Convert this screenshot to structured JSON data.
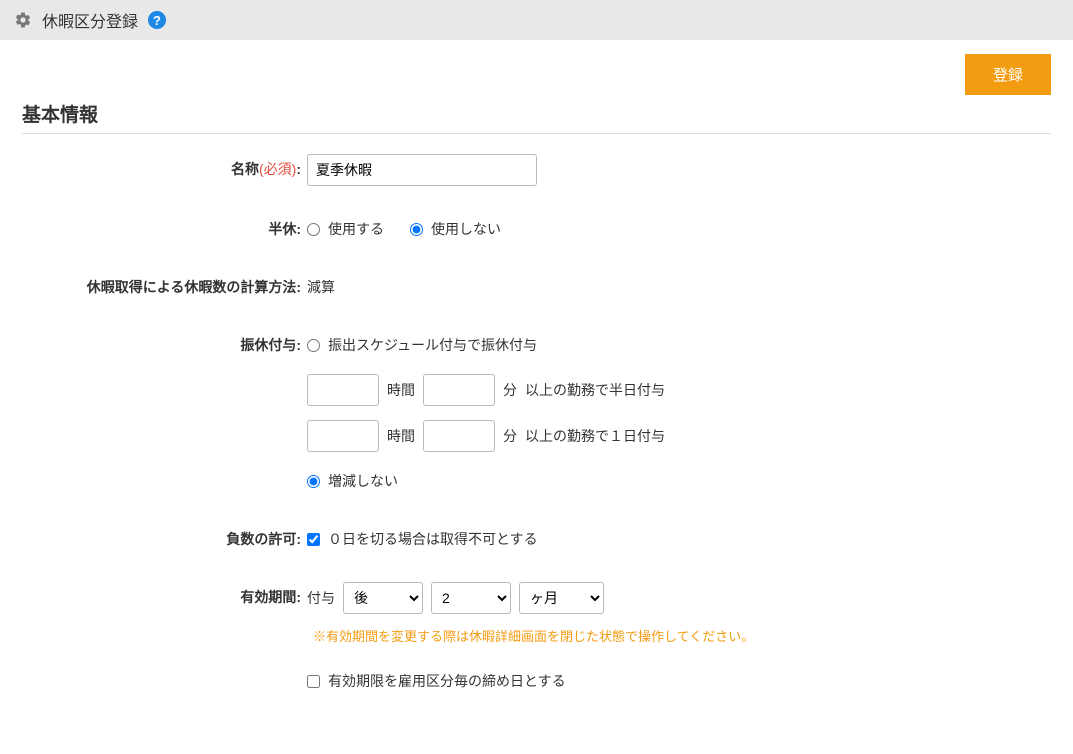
{
  "header": {
    "title": "休暇区分登録",
    "help_label": "?"
  },
  "actions": {
    "register": "登録"
  },
  "section": {
    "title": "基本情報"
  },
  "fields": {
    "name": {
      "label": "名称",
      "required": "(必須)",
      "value": "夏季休暇"
    },
    "halfday": {
      "label": "半休",
      "opt_use": "使用する",
      "opt_not_use": "使用しない"
    },
    "calc_method": {
      "label": "休暇取得による休暇数の計算方法",
      "value": "減算"
    },
    "substitute": {
      "label": "振休付与",
      "opt_schedule": "振出スケジュール付与で振休付与",
      "unit_hours": "時間",
      "unit_minutes": "分",
      "half_day_text": "以上の勤務で半日付与",
      "full_day_text": "以上の勤務で１日付与",
      "opt_none": "増減しない"
    },
    "negative": {
      "label": "負数の許可",
      "check_label": "０日を切る場合は取得不可とする"
    },
    "validity": {
      "label": "有効期間",
      "prefix": "付与",
      "timing_value": "後",
      "num_value": "2",
      "unit_value": "ヶ月",
      "warning": "※有効期間を変更する際は休暇詳細画面を閉じた状態で操作してください。",
      "closing_check": "有効期限を雇用区分毎の締め日とする"
    }
  }
}
